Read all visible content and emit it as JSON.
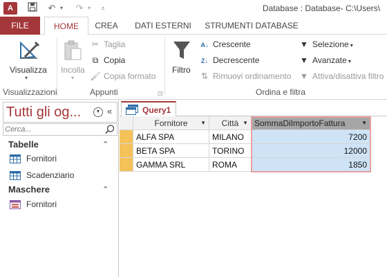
{
  "titlebar": {
    "app_icon": "A",
    "title": "Database : Database- C:\\Users\\"
  },
  "tabs": [
    {
      "label": "FILE"
    },
    {
      "label": "HOME"
    },
    {
      "label": "CREA"
    },
    {
      "label": "DATI ESTERNI"
    },
    {
      "label": "STRUMENTI DATABASE"
    }
  ],
  "ribbon": {
    "visualizzazioni": {
      "group_label": "Visualizzazioni",
      "visualizza": "Visualizza"
    },
    "appunti": {
      "group_label": "Appunti",
      "incolla": "Incolla",
      "taglia": "Taglia",
      "copia": "Copia",
      "copia_formato": "Copia formato"
    },
    "ordina": {
      "group_label": "Ordina e filtra",
      "filtro": "Filtro",
      "crescente": "Crescente",
      "decrescente": "Decrescente",
      "rimuovi": "Rimuovi ordinamento",
      "selezione": "Selezione",
      "avanzate": "Avanzate",
      "attiva": "Attiva/disattiva filtro"
    }
  },
  "nav": {
    "title": "Tutti gli og...",
    "search_placeholder": "Cerca...",
    "sections": [
      {
        "label": "Tabelle",
        "items": [
          "Fornitori",
          "Scadenziario"
        ]
      },
      {
        "label": "Maschere",
        "items": [
          "Fornitori"
        ]
      }
    ]
  },
  "document": {
    "tab_label": "Query1",
    "columns": [
      "Fornitore",
      "Città",
      "SommaDiImportoFattura"
    ],
    "rows": [
      [
        "ALFA SPA",
        "MILANO",
        "7200"
      ],
      [
        "BETA SPA",
        "TORINO",
        "12000"
      ],
      [
        "GAMMA SRL",
        "ROMA",
        "1850"
      ]
    ]
  },
  "colors": {
    "accent": "#a4373a",
    "selected_column": "#cfe3f7",
    "row_selector": "#f5c25a"
  }
}
